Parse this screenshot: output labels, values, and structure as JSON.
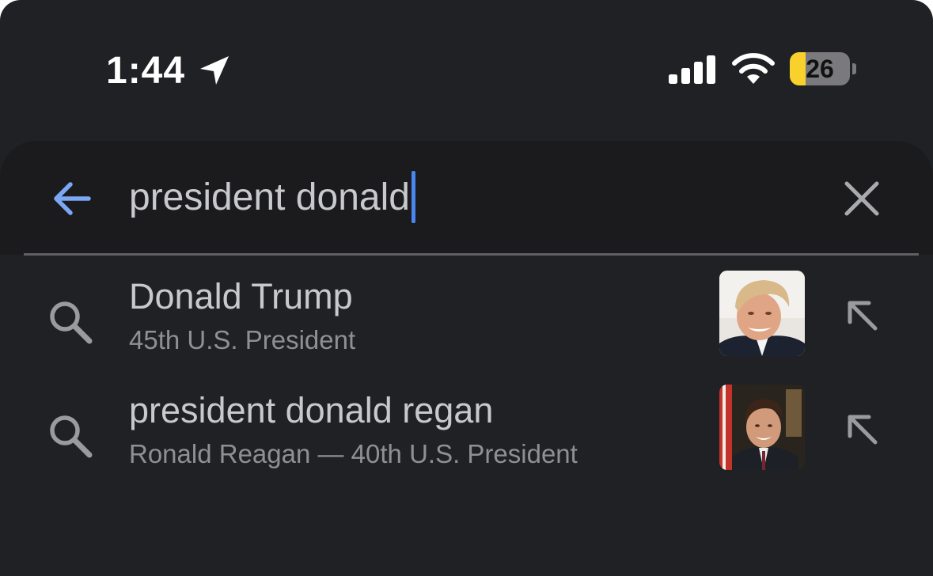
{
  "status_bar": {
    "time": "1:44",
    "battery_level": "26",
    "battery_percent": 26,
    "icons": [
      "location-arrow-icon",
      "cellular-signal-icon",
      "wifi-icon",
      "battery-icon"
    ]
  },
  "search": {
    "query": "president donald",
    "icons": {
      "back": "arrow-left-icon",
      "clear": "close-icon"
    },
    "accent_color": "#4a86f0"
  },
  "suggestions": [
    {
      "title": "Donald Trump",
      "subtitle": "45th U.S. President",
      "icon": "search-icon",
      "thumbnail": "portrait-thumbnail",
      "action_icon": "arrow-up-left-icon"
    },
    {
      "title": "president donald regan",
      "subtitle": "Ronald Reagan — 40th U.S. President",
      "icon": "search-icon",
      "thumbnail": "portrait-thumbnail",
      "action_icon": "arrow-up-left-icon"
    }
  ],
  "colors": {
    "background": "#202124",
    "search_panel": "#1b1b1d",
    "text_primary": "#c8c9cc",
    "text_secondary": "#8e9095",
    "battery_fill": "#f9d12c"
  }
}
